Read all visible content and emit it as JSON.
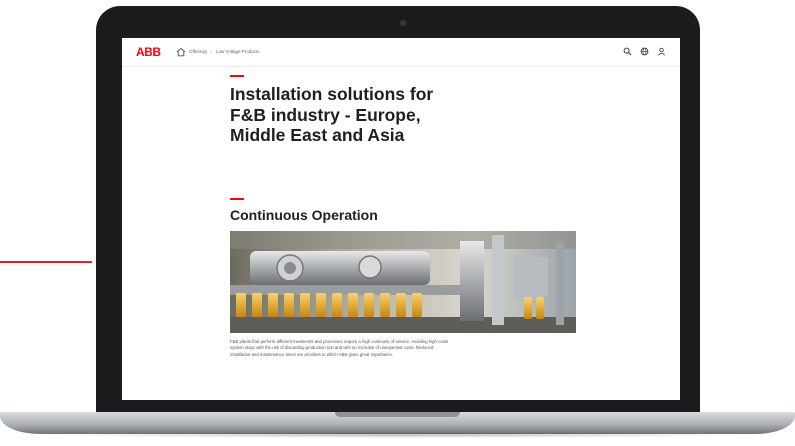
{
  "brand": {
    "logo_text": "ABB",
    "accent_color": "#ff000f"
  },
  "breadcrumb": {
    "items": [
      "Offerings",
      "Low Voltage Products"
    ]
  },
  "header_icons": [
    "search-icon",
    "globe-icon",
    "user-icon"
  ],
  "content": {
    "title": "Installation solutions for F&B industry - Europe, Middle East and Asia",
    "section_heading": "Continuous Operation",
    "hero_image": "bottling-production-line",
    "body_text": "F&B plants that perform different treatments and processes require a high continuity of service. Avoiding high costs system stops with the risk of discarding production lost and with an increase of unexpected costs. Reduced installation and maintenance times are priorities to which ABB gives great importance."
  },
  "colors": {
    "text": "#1f1f1f",
    "laptop_frame": "#1c1c1e",
    "outside_rule": "#e4202a"
  }
}
